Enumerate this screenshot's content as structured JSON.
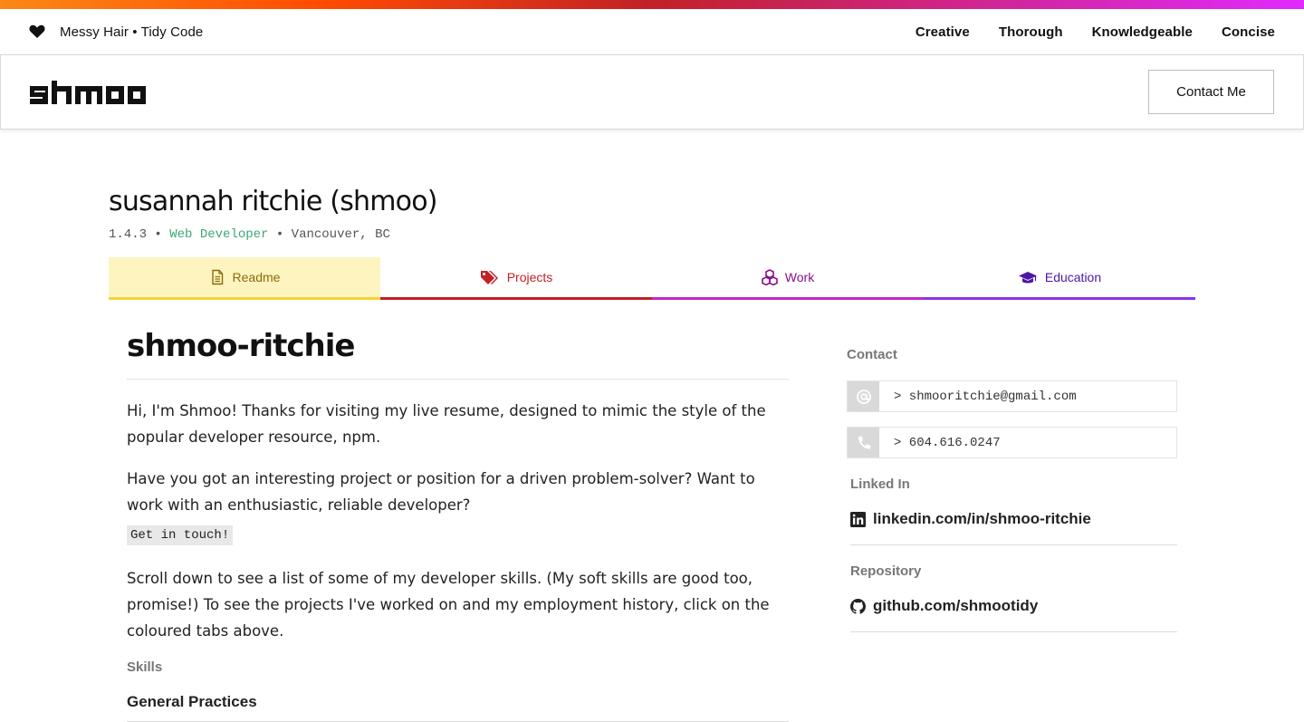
{
  "topbar": {
    "tagline": "Messy Hair • Tidy Code",
    "nav": [
      "Creative",
      "Thorough",
      "Knowledgeable",
      "Concise"
    ]
  },
  "header": {
    "logo_text": "shmoo",
    "contact_label": "Contact Me"
  },
  "package": {
    "title": "susannah ritchie (shmoo)",
    "version": "1.4.3",
    "separator": "•",
    "role": "Web Developer",
    "location": "Vancouver, BC"
  },
  "tabs": [
    {
      "label": "Readme",
      "icon": "document-icon"
    },
    {
      "label": "Projects",
      "icon": "tags-icon"
    },
    {
      "label": "Work",
      "icon": "cubes-icon"
    },
    {
      "label": "Education",
      "icon": "graduation-cap-icon"
    }
  ],
  "readme": {
    "title": "shmoo-ritchie",
    "paragraphs": [
      "Hi, I'm Shmoo! Thanks for visiting my live resume, designed to mimic the style of the popular developer resource, npm.",
      "Have you got an interesting project or position for a driven problem-solver? Want to work with an enthusiastic, reliable developer?",
      "Scroll down to see a list of some of my developer skills. (My soft skills are good too, promise!) To see the projects I've worked on and my employment history, click on the coloured tabs above."
    ],
    "code_cta": "Get in touch!",
    "skills_label": "Skills",
    "section_heading": "General Practices"
  },
  "sidebar": {
    "contact_label": "Contact",
    "email": "> shmooritchie@gmail.com",
    "phone": "> 604.616.0247",
    "linkedin_label": "Linked In",
    "linkedin": "linkedin.com/in/shmoo-ritchie",
    "repo_label": "Repository",
    "repo": "github.com/shmootidy"
  },
  "colors": {
    "readme": "#f5d335",
    "projects": "#c12127",
    "work": "#c02ac4",
    "education": "#8b35e0",
    "role": "#3da776"
  }
}
